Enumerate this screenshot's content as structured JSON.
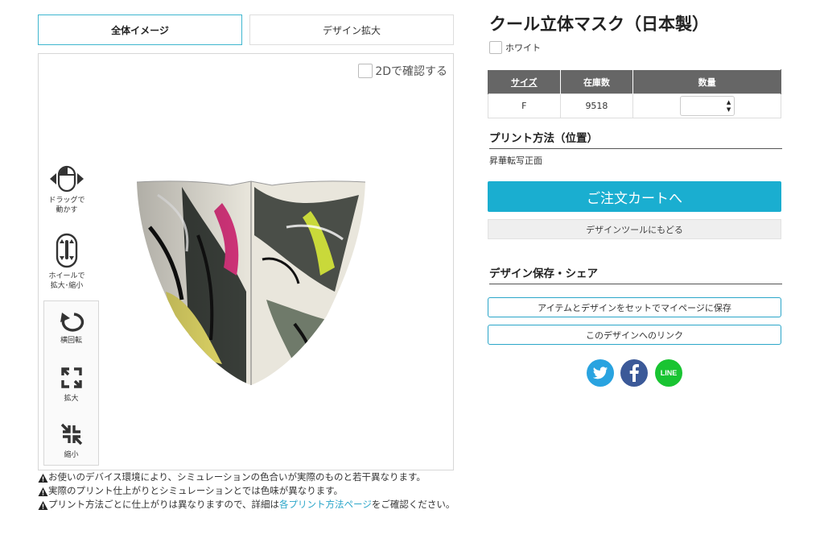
{
  "viewer": {
    "tabs": {
      "full_image": "全体イメージ",
      "design_zoom": "デザイン拡大"
    },
    "check_2d": "2Dで確認する",
    "hints": {
      "drag": [
        "ドラッグで",
        "動かす"
      ],
      "wheel": [
        "ホイールで",
        "拡大･縮小"
      ]
    },
    "controls": {
      "rotate": "横回転",
      "zoom_in": "拡大",
      "zoom_out": "縮小"
    }
  },
  "notes": {
    "note1": "お使いのデバイス環境により、シミュレーションの色合いが実際のものと若干異なります。",
    "note2": "実際のプリント仕上がりとシミュレーションとでは色味が異なります。",
    "note3_before": "プリント方法ごとに仕上がりは異なりますので、詳細は",
    "note3_link": "各プリント方法ページ",
    "note3_after": "をご確認ください。"
  },
  "product": {
    "title": "クール立体マスク（日本製）",
    "color": "ホワイト",
    "table": {
      "headers": [
        "サイズ",
        "在庫数",
        "数量"
      ],
      "rows": [
        {
          "size": "F",
          "stock": "9518"
        }
      ]
    },
    "print_section": {
      "heading": "プリント方法（位置）",
      "method": "昇華転写正面"
    },
    "buttons": {
      "cart": "ご注文カートへ",
      "back": "デザインツールにもどる"
    },
    "save_section": {
      "heading": "デザイン保存・シェア",
      "save_button": "アイテムとデザインをセットでマイページに保存",
      "link_button": "このデザインへのリンク"
    },
    "social": {
      "line": "LINE"
    }
  },
  "colors": {
    "accent": "#1aaed0",
    "table_header": "#666666",
    "twitter": "#29a3e0",
    "facebook": "#3b5998",
    "line": "#19c432"
  }
}
